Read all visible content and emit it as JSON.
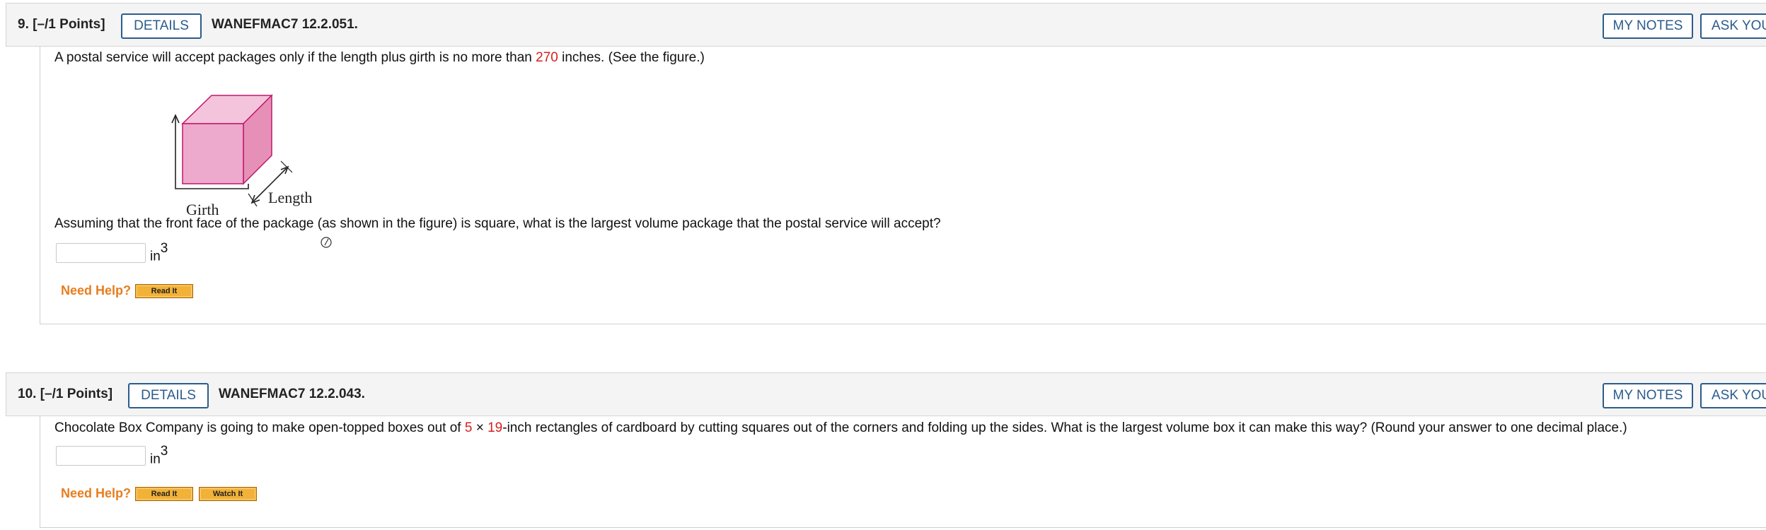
{
  "questions": [
    {
      "number_points": "9. [–/1 Points]",
      "details_label": "DETAILS",
      "code": "WANEFMAC7 12.2.051.",
      "my_notes_label": "MY NOTES",
      "ask_label": "ASK YOUR",
      "problem_text_a": "A postal service will accept packages only if the length plus girth is no more than ",
      "problem_highlight": "270",
      "problem_text_b": " inches. (See the figure.)",
      "figure_labels": {
        "girth": "Girth",
        "length": "Length"
      },
      "question_text": "Assuming that the front face of the package (as shown in the figure) is square, what is the largest volume package that the postal service will accept?",
      "answer_value": "",
      "unit": "in",
      "unit_power": "3",
      "need_help_label": "Need Help?",
      "help_buttons": [
        "Read It"
      ]
    },
    {
      "number_points": "10. [–/1 Points]",
      "details_label": "DETAILS",
      "code": "WANEFMAC7 12.2.043.",
      "my_notes_label": "MY NOTES",
      "ask_label": "ASK YOUR",
      "problem_text_a": "Chocolate Box Company is going to make open-topped boxes out of ",
      "problem_dim1": "5",
      "problem_times": " × ",
      "problem_dim2": "19",
      "problem_text_b": "-inch rectangles of cardboard by cutting squares out of the corners and folding up the sides. What is the largest volume box it can make this way? (Round your answer to one decimal place.)",
      "answer_value": "",
      "unit": "in",
      "unit_power": "3",
      "need_help_label": "Need Help?",
      "help_buttons": [
        "Read It",
        "Watch It"
      ]
    }
  ],
  "colors": {
    "accent": "#2b5c8c",
    "highlight": "#d6201f",
    "help": "#e87d1e",
    "box_pink": "#eeaacc"
  }
}
